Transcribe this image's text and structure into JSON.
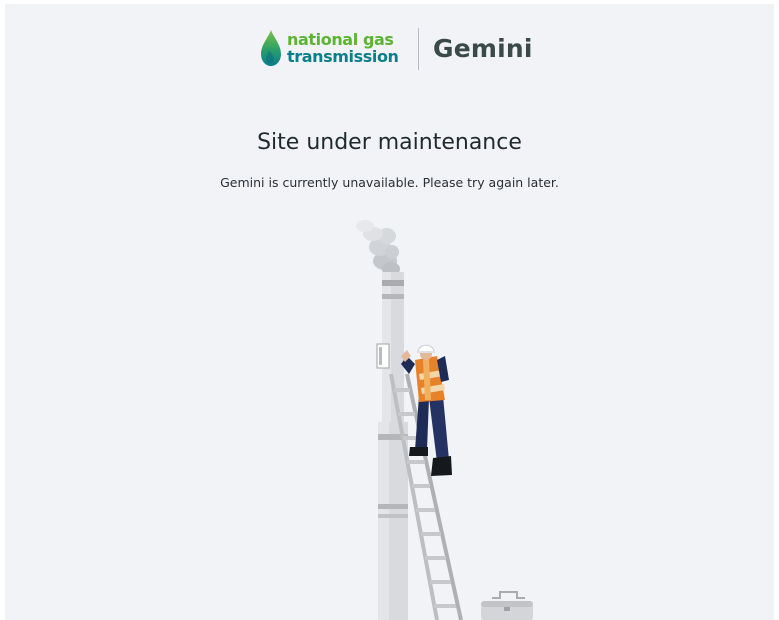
{
  "header": {
    "brand_line1": "national gas",
    "brand_line2": "transmission",
    "product_name": "Gemini"
  },
  "main": {
    "title": "Site under maintenance",
    "message": "Gemini is currently unavailable. Please try again later."
  },
  "colors": {
    "background": "#f2f3f7",
    "brand_green": "#5bb432",
    "brand_teal": "#0b7f8a",
    "text_dark": "#1f2a2d",
    "hivis_orange": "#e8822a"
  },
  "illustration": {
    "icons": [
      "chimney-icon",
      "smoke-icon",
      "ladder-icon",
      "worker-icon",
      "toolbox-icon"
    ]
  }
}
